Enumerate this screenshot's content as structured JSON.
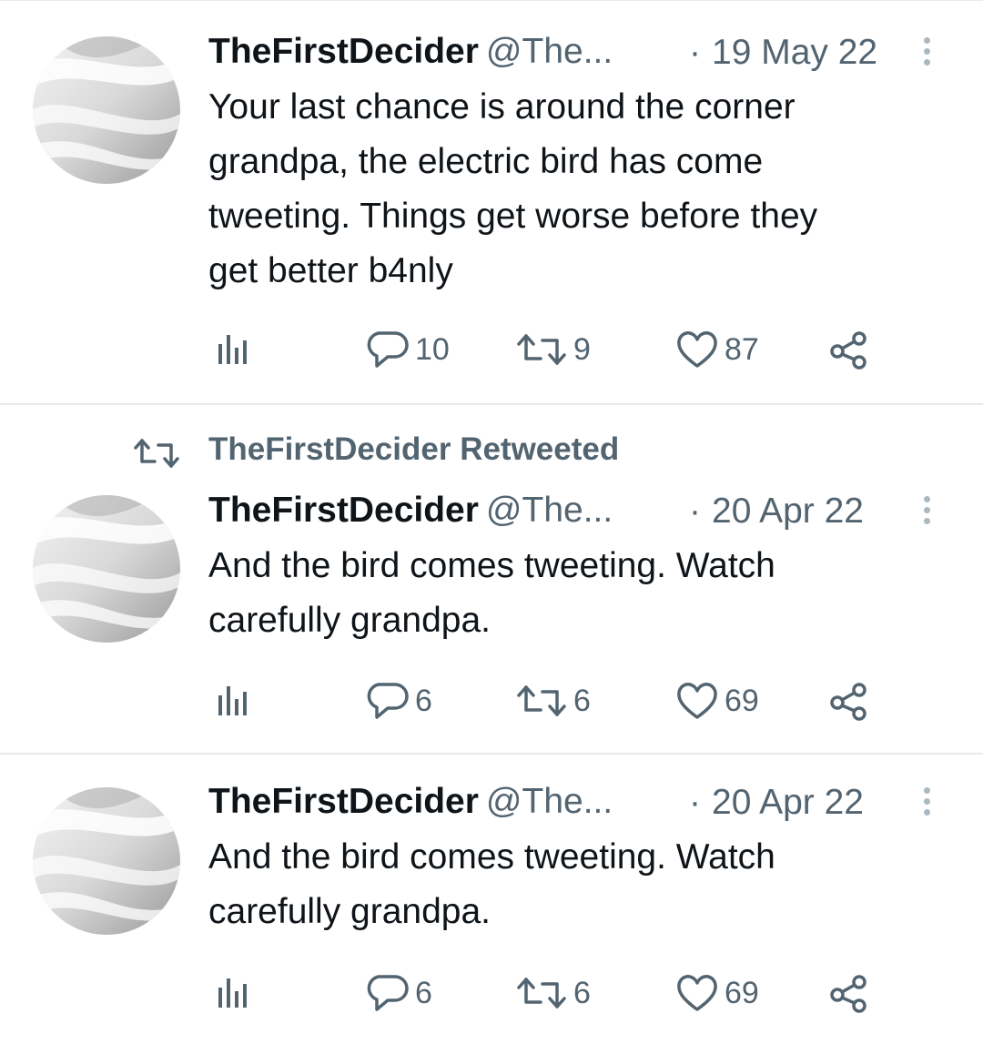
{
  "retweet_context": {
    "label": "TheFirstDecider Retweeted"
  },
  "tweets": [
    {
      "name": "TheFirstDecider",
      "handle": "@The...",
      "date": "19 May 22",
      "text_lines": [
        "Your last chance is around the corner",
        "grandpa, the electric bird has come",
        "tweeting. Things get worse before they",
        "get better b4nly"
      ],
      "replies": "10",
      "retweets": "9",
      "likes": "87"
    },
    {
      "name": "TheFirstDecider",
      "handle": "@The...",
      "date": "20 Apr 22",
      "text_lines": [
        "And the bird comes tweeting. Watch",
        "carefully grandpa."
      ],
      "replies": "6",
      "retweets": "6",
      "likes": "69"
    },
    {
      "name": "TheFirstDecider",
      "handle": "@The...",
      "date": "20 Apr 22",
      "text_lines": [
        "And the bird comes tweeting. Watch",
        "carefully grandpa."
      ],
      "replies": "6",
      "retweets": "6",
      "likes": "69"
    }
  ],
  "icons": {
    "views": "bar-chart-icon",
    "reply": "speech-bubble-icon",
    "retweet": "retweet-icon",
    "like": "heart-icon",
    "share": "share-icon",
    "more": "vertical-dots-icon"
  },
  "colors": {
    "text": "#0f1419",
    "secondary": "#536471",
    "divider": "#e7e9ea"
  }
}
